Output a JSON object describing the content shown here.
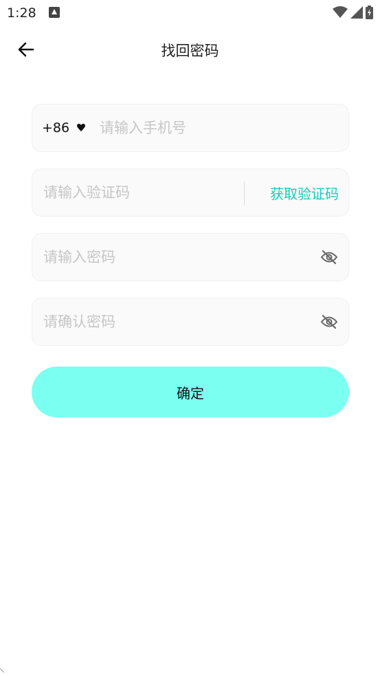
{
  "status_bar": {
    "time": "1:28",
    "icons": [
      "notification-icon",
      "wifi-icon",
      "signal-icon",
      "battery-icon"
    ]
  },
  "header": {
    "title": "找回密码",
    "back_icon": "arrow-left-icon"
  },
  "form": {
    "phone": {
      "country_code": "+86",
      "dropdown_icon": "caret-down-icon",
      "placeholder": "请输入手机号",
      "value": ""
    },
    "verification": {
      "placeholder": "请输入验证码",
      "value": "",
      "get_code_label": "获取验证码"
    },
    "password": {
      "placeholder": "请输入密码",
      "value": "",
      "toggle_icon": "eye-off-icon"
    },
    "confirm_password": {
      "placeholder": "请确认密码",
      "value": "",
      "toggle_icon": "eye-off-icon"
    },
    "submit_label": "确定"
  },
  "colors": {
    "accent": "#19c9bd",
    "button_bg": "#7bfff1",
    "field_bg": "#fafafa",
    "placeholder": "#c6c6c6"
  }
}
